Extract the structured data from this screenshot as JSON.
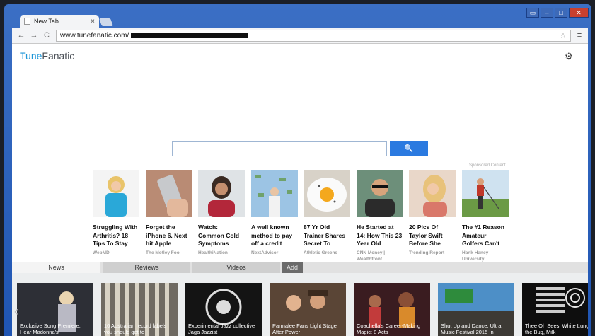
{
  "browser": {
    "tab_title": "New Tab",
    "tab_close": "×",
    "url": "www.tunefanatic.com/",
    "controls": {
      "back": "←",
      "forward": "→",
      "reload": "C",
      "star": "☆",
      "menu": "≡"
    },
    "window_buttons": {
      "restore": "▭",
      "minimize": "–",
      "maximize": "□",
      "close": "✕"
    }
  },
  "page": {
    "logo": {
      "part1": "Tune",
      "part2": "Fanatic"
    },
    "settings_icon": "⚙",
    "search_icon": "🔍",
    "sponsored_label": "Sponsored Content",
    "cards": [
      {
        "headline": "Struggling With Arthritis? 18 Tips To Stay",
        "source": "WebMD"
      },
      {
        "headline": "Forget the iPhone 6. Next hit Apple",
        "source": "The Motley Fool"
      },
      {
        "headline": "Watch: Common Cold Symptoms",
        "source": "HealthiNation"
      },
      {
        "headline": "A well known method to pay off a credit",
        "source": "NextAdvisor"
      },
      {
        "headline": "87 Yr Old Trainer Shares Secret To",
        "source": "Athletic Greens"
      },
      {
        "headline": "He Started at 14: How This 23 Year Old",
        "source": "CNN Money | Wealthfront"
      },
      {
        "headline": "20 Pics Of Taylor Swift Before She",
        "source": "Trending.Report"
      },
      {
        "headline": "The #1 Reason Amateur Golfers Can't",
        "source": "Hank Haney University"
      }
    ],
    "tabs": {
      "news": "News",
      "reviews": "Reviews",
      "videos": "Videos",
      "add": "Add"
    },
    "videos": [
      {
        "caption": "Exclusive Song Premiere: Hear Madonna's"
      },
      {
        "caption": "10 Australian record labels you should get to"
      },
      {
        "caption": "Experimental Jazz collective Jaga Jazzist"
      },
      {
        "caption": "Parmalee Fans Light Stage After Power"
      },
      {
        "caption": "Coachella's Career-Making Magic: 8 Acts"
      },
      {
        "caption": "Shut Up and Dance: Ultra Music Festival 2015 In"
      },
      {
        "caption": "Thee Oh Sees, White Lung, the Bug, Milk"
      }
    ],
    "prev_arrow": "‹"
  }
}
